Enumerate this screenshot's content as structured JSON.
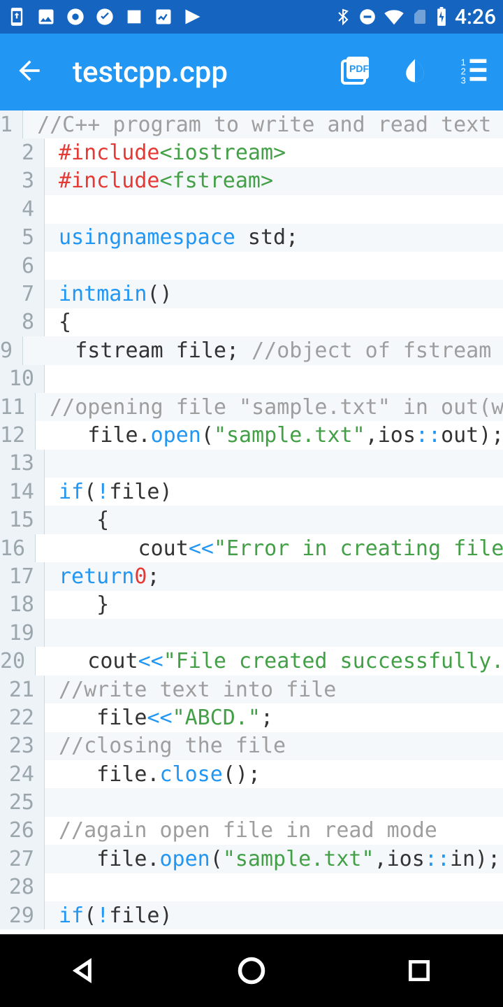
{
  "status": {
    "time": "4:26"
  },
  "appbar": {
    "title": "testcpp.cpp"
  },
  "code": {
    "lines": [
      {
        "n": 1,
        "html": "<span class='cm'>//C++ program to write and read text in</span>"
      },
      {
        "n": 2,
        "html": "<span class='pre'>#include</span> <span class='inc'>&lt;iostream&gt;</span>"
      },
      {
        "n": 3,
        "html": "<span class='pre'>#include</span> <span class='inc'>&lt;fstream&gt;</span>"
      },
      {
        "n": 4,
        "html": ""
      },
      {
        "n": 5,
        "html": "<span class='kw'>using</span> <span class='kw'>namespace</span> std;"
      },
      {
        "n": 6,
        "html": ""
      },
      {
        "n": 7,
        "html": "<span class='kw'>int</span> <span class='fn'>main</span>()"
      },
      {
        "n": 8,
        "html": "{"
      },
      {
        "n": 9,
        "html": "   fstream file; <span class='cm'>//object of fstream cl</span>"
      },
      {
        "n": 10,
        "html": "   "
      },
      {
        "n": 11,
        "html": "   <span class='cm'>//opening file \"sample.txt\" in out(w</span>"
      },
      {
        "n": 12,
        "html": "   file.<span class='fn'>open</span>(<span class='str'>\"sample.txt\"</span>,ios<span class='sc'>::</span>out);"
      },
      {
        "n": 13,
        "html": "   "
      },
      {
        "n": 14,
        "html": "   <span class='kw'>if</span>(<span class='op'>!</span>file)"
      },
      {
        "n": 15,
        "html": "   {"
      },
      {
        "n": 16,
        "html": "       cout<span class='op'>&lt;&lt;</span><span class='str'>\"Error in creating file!!!</span>"
      },
      {
        "n": 17,
        "html": "       <span class='kw'>return</span> <span class='num'>0</span>;"
      },
      {
        "n": 18,
        "html": "   }"
      },
      {
        "n": 19,
        "html": "   "
      },
      {
        "n": 20,
        "html": "   cout<span class='op'>&lt;&lt;</span><span class='str'>\"File created successfully.\"</span><span class='op'>&lt;&lt;</span>"
      },
      {
        "n": 21,
        "html": "   <span class='cm'>//write text into file</span>"
      },
      {
        "n": 22,
        "html": "   file<span class='op'>&lt;&lt;</span><span class='str'>\"ABCD.\"</span>;"
      },
      {
        "n": 23,
        "html": "   <span class='cm'>//closing the file</span>"
      },
      {
        "n": 24,
        "html": "   file.<span class='fn'>close</span>();"
      },
      {
        "n": 25,
        "html": "   "
      },
      {
        "n": 26,
        "html": "   <span class='cm'>//again open file in read mode</span>"
      },
      {
        "n": 27,
        "html": "   file.<span class='fn'>open</span>(<span class='str'>\"sample.txt\"</span>,ios<span class='sc'>::</span>in);"
      },
      {
        "n": 28,
        "html": "   "
      },
      {
        "n": 29,
        "html": "   <span class='kw'>if</span>(<span class='op'>!</span>file)"
      }
    ]
  }
}
